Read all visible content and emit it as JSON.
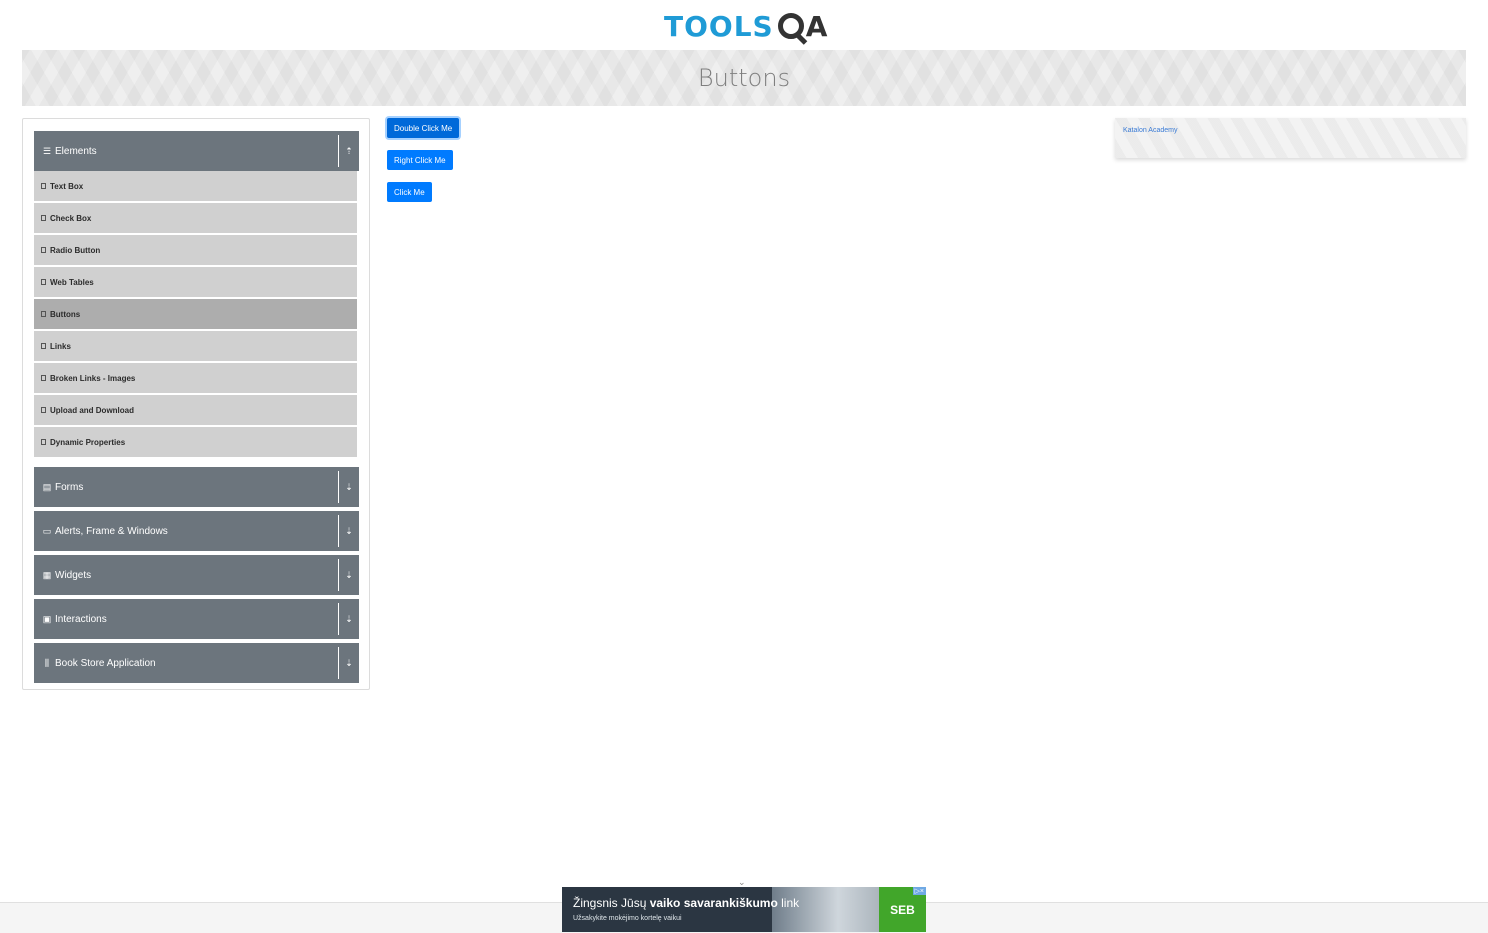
{
  "header": {
    "logo_tools": "TOOLS",
    "logo_qa": "A"
  },
  "banner": {
    "title": "Buttons"
  },
  "sidebar": {
    "groups": [
      {
        "label": "Elements",
        "icon": "hamburger-icon",
        "expanded": true
      },
      {
        "label": "Forms",
        "icon": "form-icon",
        "expanded": false
      },
      {
        "label": "Alerts, Frame & Windows",
        "icon": "window-icon",
        "expanded": false
      },
      {
        "label": "Widgets",
        "icon": "grid-icon",
        "expanded": false
      },
      {
        "label": "Interactions",
        "icon": "interaction-icon",
        "expanded": false
      },
      {
        "label": "Book Store Application",
        "icon": "library-icon",
        "expanded": false
      }
    ],
    "items": [
      {
        "label": "Text Box"
      },
      {
        "label": "Check Box"
      },
      {
        "label": "Radio Button"
      },
      {
        "label": "Web Tables"
      },
      {
        "label": "Buttons",
        "active": true
      },
      {
        "label": "Links"
      },
      {
        "label": "Broken Links - Images"
      },
      {
        "label": "Upload and Download"
      },
      {
        "label": "Dynamic Properties"
      }
    ]
  },
  "main": {
    "double_click_label": "Double Click Me",
    "right_click_label": "Right Click Me",
    "click_label": "Click Me"
  },
  "right_ad": {
    "alt_text": "Katalon Academy"
  },
  "bottom_ad": {
    "headline_pre": "Žingsnis Jūsų ",
    "headline_bold": "vaiko savarankiškumo",
    "headline_post": " link",
    "sub": "Užsakykite mokėjimo kortelę vaikui",
    "brand": "SEB"
  },
  "colors": {
    "primary": "#007bff",
    "sidebar_header": "#6c757d",
    "logo_blue": "#1f9bd6"
  }
}
